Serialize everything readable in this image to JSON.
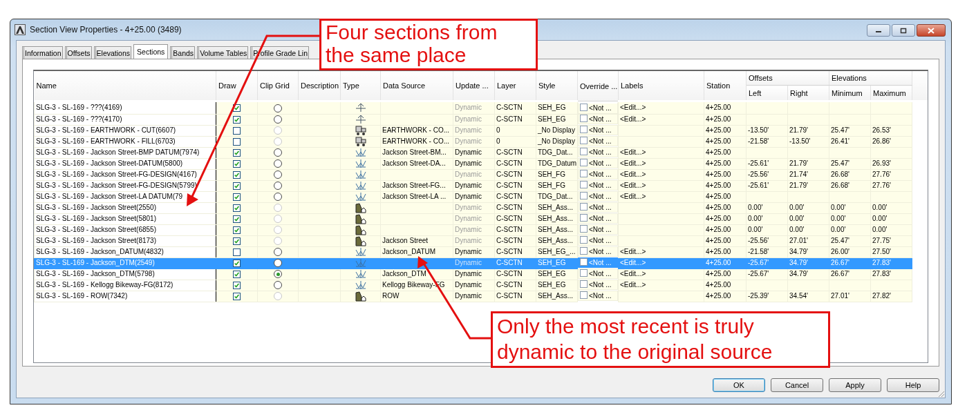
{
  "window": {
    "title": "Section View Properties - 4+25.00 (3489)"
  },
  "tabs": [
    {
      "label": "Information",
      "selected": false
    },
    {
      "label": "Offsets",
      "selected": false
    },
    {
      "label": "Elevations",
      "selected": false
    },
    {
      "label": "Sections",
      "selected": true
    },
    {
      "label": "Bands",
      "selected": false
    },
    {
      "label": "Volume Tables",
      "selected": false
    },
    {
      "label": "Profile Grade Lin",
      "selected": false
    }
  ],
  "table": {
    "columns": [
      "Name",
      "Draw",
      "Clip Grid",
      "Description",
      "Type",
      "Data Source",
      "Update ...",
      "Layer",
      "Style",
      "Override ...",
      "Labels",
      "Station"
    ],
    "offsets_group": "Offsets",
    "offsets_columns": [
      "Left",
      "Right"
    ],
    "elevations_group": "Elevations",
    "elevations_columns": [
      "Minimum",
      "Maximum"
    ],
    "rows": [
      {
        "name": "SLG-3 - SL-169 - ???(4169)",
        "draw": true,
        "clip_selected": false,
        "clip_disabled": false,
        "kind": "baseline",
        "data_source": "",
        "update": "Dynamic",
        "update_dimmed": true,
        "layer": "C-SCTN",
        "style": "SEH_EG",
        "override_checked": false,
        "override": "<Not ...",
        "labels": "<Edit...>",
        "station": "4+25.00",
        "left": "",
        "right": "",
        "minimum": "",
        "maximum": "",
        "selected": false
      },
      {
        "name": "SLG-3 - SL-169 - ???(4170)",
        "draw": true,
        "clip_selected": false,
        "clip_disabled": false,
        "kind": "baseline",
        "data_source": "",
        "update": "Dynamic",
        "update_dimmed": true,
        "layer": "C-SCTN",
        "style": "SEH_EG",
        "override_checked": false,
        "override": "<Not ...",
        "labels": "<Edit...>",
        "station": "4+25.00",
        "left": "",
        "right": "",
        "minimum": "",
        "maximum": "",
        "selected": false
      },
      {
        "name": "SLG-3 - SL-169 - EARTHWORK - CUT(6607)",
        "draw": false,
        "clip_selected": false,
        "clip_disabled": true,
        "kind": "material",
        "data_source": "EARTHWORK - CO...",
        "update": "Dynamic",
        "update_dimmed": true,
        "layer": "0",
        "style": "_No Display",
        "override_checked": false,
        "override": "<Not ...",
        "labels": "",
        "station": "4+25.00",
        "left": "-13.50'",
        "right": "21.79'",
        "minimum": "25.47'",
        "maximum": "26.53'",
        "selected": false
      },
      {
        "name": "SLG-3 - SL-169 - EARTHWORK - FILL(6703)",
        "draw": false,
        "clip_selected": false,
        "clip_disabled": true,
        "kind": "material",
        "data_source": "EARTHWORK - CO...",
        "update": "Dynamic",
        "update_dimmed": true,
        "layer": "0",
        "style": "_No Display",
        "override_checked": false,
        "override": "<Not ...",
        "labels": "",
        "station": "4+25.00",
        "left": "-21.58'",
        "right": "-13.50'",
        "minimum": "26.41'",
        "maximum": "26.86'",
        "selected": false
      },
      {
        "name": "SLG-3 - SL-169 - Jackson Street-BMP DATUM(7974)",
        "draw": true,
        "clip_selected": false,
        "clip_disabled": false,
        "kind": "surface",
        "data_source": "Jackson Street-BM...",
        "update": "Dynamic",
        "update_dimmed": false,
        "layer": "C-SCTN",
        "style": "TDG_Dat...",
        "override_checked": false,
        "override": "<Not ...",
        "labels": "<Edit...>",
        "station": "4+25.00",
        "left": "",
        "right": "",
        "minimum": "",
        "maximum": "",
        "selected": false
      },
      {
        "name": "SLG-3 - SL-169 - Jackson Street-DATUM(5800)",
        "draw": true,
        "clip_selected": false,
        "clip_disabled": false,
        "kind": "surface",
        "data_source": "Jackson Street-DA...",
        "update": "Dynamic",
        "update_dimmed": false,
        "layer": "C-SCTN",
        "style": "TDG_Datum",
        "override_checked": false,
        "override": "<Not ...",
        "labels": "<Edit...>",
        "station": "4+25.00",
        "left": "-25.61'",
        "right": "21.79'",
        "minimum": "25.47'",
        "maximum": "26.93'",
        "selected": false
      },
      {
        "name": "SLG-3 - SL-169 - Jackson Street-FG-DESIGN(4167)",
        "draw": true,
        "clip_selected": false,
        "clip_disabled": false,
        "kind": "surface",
        "data_source": "",
        "update": "Dynamic",
        "update_dimmed": true,
        "layer": "C-SCTN",
        "style": "SEH_FG",
        "override_checked": false,
        "override": "<Not ...",
        "labels": "<Edit...>",
        "station": "4+25.00",
        "left": "-25.56'",
        "right": "21.74'",
        "minimum": "26.68'",
        "maximum": "27.76'",
        "selected": false
      },
      {
        "name": "SLG-3 - SL-169 - Jackson Street-FG-DESIGN(5799)",
        "draw": true,
        "clip_selected": false,
        "clip_disabled": false,
        "kind": "surface",
        "data_source": "Jackson Street-FG...",
        "update": "Dynamic",
        "update_dimmed": false,
        "layer": "C-SCTN",
        "style": "SEH_FG",
        "override_checked": false,
        "override": "<Not ...",
        "labels": "<Edit...>",
        "station": "4+25.00",
        "left": "-25.61'",
        "right": "21.79'",
        "minimum": "26.68'",
        "maximum": "27.76'",
        "selected": false
      },
      {
        "name": "SLG-3 - SL-169 - Jackson Street-LA DATUM(79",
        "draw": true,
        "clip_selected": false,
        "clip_disabled": false,
        "kind": "surface",
        "data_source": "Jackson Street-LA ...",
        "update": "Dynamic",
        "update_dimmed": false,
        "layer": "C-SCTN",
        "style": "TDG_Dat...",
        "override_checked": false,
        "override": "<Not ...",
        "labels": "<Edit...>",
        "station": "4+25.00",
        "left": "",
        "right": "",
        "minimum": "",
        "maximum": "",
        "selected": false
      },
      {
        "name": "SLG-3 - SL-169 - Jackson Street(2550)",
        "draw": true,
        "clip_selected": false,
        "clip_disabled": true,
        "kind": "corridor",
        "data_source": "",
        "update": "Dynamic",
        "update_dimmed": true,
        "layer": "C-SCTN",
        "style": "SEH_Ass...",
        "override_checked": false,
        "override": "<Not ...",
        "labels": "",
        "station": "4+25.00",
        "left": "0.00'",
        "right": "0.00'",
        "minimum": "0.00'",
        "maximum": "0.00'",
        "selected": false
      },
      {
        "name": "SLG-3 - SL-169 - Jackson Street(5801)",
        "draw": true,
        "clip_selected": false,
        "clip_disabled": true,
        "kind": "corridor",
        "data_source": "",
        "update": "Dynamic",
        "update_dimmed": true,
        "layer": "C-SCTN",
        "style": "SEH_Ass...",
        "override_checked": false,
        "override": "<Not ...",
        "labels": "",
        "station": "4+25.00",
        "left": "0.00'",
        "right": "0.00'",
        "minimum": "0.00'",
        "maximum": "0.00'",
        "selected": false
      },
      {
        "name": "SLG-3 - SL-169 - Jackson Street(6855)",
        "draw": true,
        "clip_selected": false,
        "clip_disabled": true,
        "kind": "corridor",
        "data_source": "",
        "update": "Dynamic",
        "update_dimmed": true,
        "layer": "C-SCTN",
        "style": "SEH_Ass...",
        "override_checked": false,
        "override": "<Not ...",
        "labels": "",
        "station": "4+25.00",
        "left": "0.00'",
        "right": "0.00'",
        "minimum": "0.00'",
        "maximum": "0.00'",
        "selected": false
      },
      {
        "name": "SLG-3 - SL-169 - Jackson Street(8173)",
        "draw": true,
        "clip_selected": false,
        "clip_disabled": true,
        "kind": "corridor",
        "data_source": "Jackson Street",
        "update": "Dynamic",
        "update_dimmed": true,
        "layer": "C-SCTN",
        "style": "SEH_Ass...",
        "override_checked": false,
        "override": "<Not ...",
        "labels": "",
        "station": "4+25.00",
        "left": "-25.56'",
        "right": "27.01'",
        "minimum": "25.47'",
        "maximum": "27.75'",
        "selected": false
      },
      {
        "name": "SLG-3 - SL-169 - Jackson_DATUM(4832)",
        "draw": false,
        "clip_selected": false,
        "clip_disabled": false,
        "kind": "surface",
        "data_source": "Jackson_DATUM",
        "update": "Dynamic",
        "update_dimmed": false,
        "layer": "C-SCTN",
        "style": "SEH_EG_...",
        "override_checked": false,
        "override": "<Not ...",
        "labels": "<Edit...>",
        "station": "4+25.00",
        "left": "-21.58'",
        "right": "34.79'",
        "minimum": "26.00'",
        "maximum": "27.50'",
        "selected": false
      },
      {
        "name": "SLG-3 - SL-169 - Jackson_DTM(2549)",
        "draw": true,
        "clip_selected": false,
        "clip_disabled": false,
        "kind": "surface",
        "data_source": "",
        "update": "Dynamic",
        "update_dimmed": true,
        "layer": "C-SCTN",
        "style": "SEH_EG",
        "override_checked": false,
        "override": "<Not ...",
        "labels": "<Edit...>",
        "station": "4+25.00",
        "left": "-25.67'",
        "right": "34.79'",
        "minimum": "26.67'",
        "maximum": "27.83'",
        "selected": true
      },
      {
        "name": "SLG-3 - SL-169 - Jackson_DTM(5798)",
        "draw": true,
        "clip_selected": true,
        "clip_disabled": false,
        "kind": "surface",
        "data_source": "Jackson_DTM",
        "update": "Dynamic",
        "update_dimmed": false,
        "layer": "C-SCTN",
        "style": "SEH_EG",
        "override_checked": false,
        "override": "<Not ...",
        "labels": "<Edit...>",
        "station": "4+25.00",
        "left": "-25.67'",
        "right": "34.79'",
        "minimum": "26.67'",
        "maximum": "27.83'",
        "selected": false
      },
      {
        "name": "SLG-3 - SL-169 - Kellogg Bikeway-FG(8172)",
        "draw": true,
        "clip_selected": false,
        "clip_disabled": false,
        "kind": "surface",
        "data_source": "Kellogg Bikeway-FG",
        "update": "Dynamic",
        "update_dimmed": false,
        "layer": "C-SCTN",
        "style": "SEH_EG",
        "override_checked": false,
        "override": "<Not ...",
        "labels": "<Edit...>",
        "station": "4+25.00",
        "left": "",
        "right": "",
        "minimum": "",
        "maximum": "",
        "selected": false
      },
      {
        "name": "SLG-3 - SL-169 - ROW(7342)",
        "draw": true,
        "clip_selected": false,
        "clip_disabled": true,
        "kind": "corridor",
        "data_source": "ROW",
        "update": "Dynamic",
        "update_dimmed": false,
        "layer": "C-SCTN",
        "style": "SEH_Ass...",
        "override_checked": false,
        "override": "<Not ...",
        "labels": "",
        "station": "4+25.00",
        "left": "-25.39'",
        "right": "34.54'",
        "minimum": "27.01'",
        "maximum": "27.82'",
        "selected": false
      }
    ]
  },
  "buttons": [
    {
      "label": "OK",
      "default": true
    },
    {
      "label": "Cancel",
      "default": false
    },
    {
      "label": "Apply",
      "default": false
    },
    {
      "label": "Help",
      "default": false
    }
  ],
  "annotations": [
    {
      "text": "Four sections from the same place"
    },
    {
      "text": "Only the most recent is truly dynamic to the original source"
    }
  ]
}
